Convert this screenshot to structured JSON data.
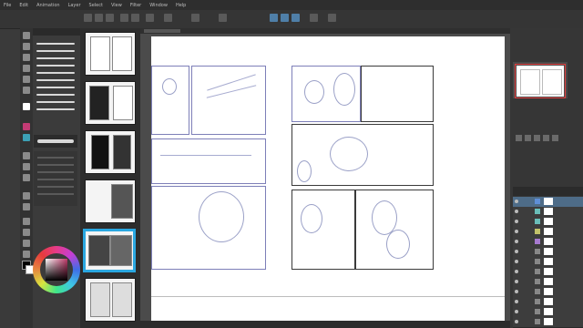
{
  "menu": [
    "File",
    "Edit",
    "Animation",
    "Layer",
    "Select",
    "View",
    "Filter",
    "Window",
    "Help"
  ],
  "icons": {
    "tool_icons": [
      "zoom-icon",
      "move-icon",
      "selection-icon",
      "eyedropper-icon",
      "pen-icon",
      "pencil-icon",
      "brush-icon",
      "airbrush-icon",
      "decoration-icon",
      "eraser-icon",
      "fill-icon",
      "gradient-icon",
      "figure-icon",
      "frame-icon",
      "ruler-icon",
      "text-icon",
      "balloon-icon",
      "correct-line-icon"
    ]
  },
  "colors": {
    "accent": "#2aa7e0",
    "panel_border": "#7d7fb8",
    "foreground": "#000000",
    "background": "#ffffff",
    "selected_layer": "#4e6c88"
  },
  "layers": [
    {
      "color": "#5f8fd6"
    },
    {
      "color": "#6abeb9"
    },
    {
      "color": "#6abeb9"
    },
    {
      "color": "#c2c26a"
    },
    {
      "color": "#a77ad0"
    },
    {
      "color": "#888888"
    },
    {
      "color": "#888888"
    },
    {
      "color": "#888888"
    },
    {
      "color": "#888888"
    },
    {
      "color": "#888888"
    },
    {
      "color": "#888888"
    },
    {
      "color": "#888888"
    },
    {
      "color": "#888888"
    }
  ]
}
